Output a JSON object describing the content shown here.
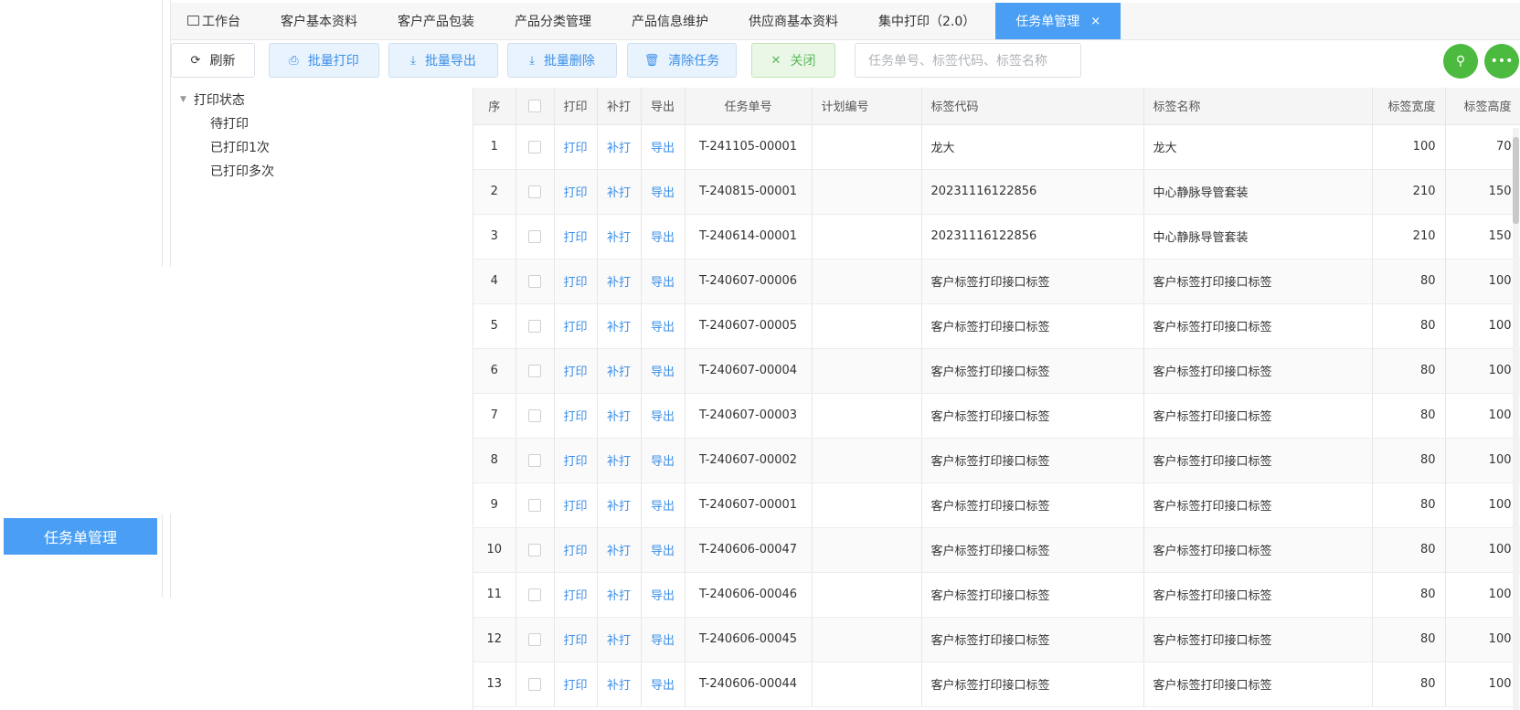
{
  "side_tab": "任务单管理",
  "tabs": [
    {
      "label": "工作台"
    },
    {
      "label": "客户基本资料"
    },
    {
      "label": "客户产品包装"
    },
    {
      "label": "产品分类管理"
    },
    {
      "label": "产品信息维护"
    },
    {
      "label": "供应商基本资料"
    },
    {
      "label": "集中打印（2.0）"
    },
    {
      "label": "任务单管理",
      "close": "×"
    }
  ],
  "toolbar": {
    "refresh": "刷新",
    "batch_print": "批量打印",
    "batch_export": "批量导出",
    "batch_delete": "批量删除",
    "clear_tasks": "清除任务",
    "close": "关闭",
    "search_placeholder": "任务单号、标签代码、标签名称"
  },
  "tree": {
    "root": "打印状态",
    "children": [
      "待打印",
      "已打印1次",
      "已打印多次"
    ]
  },
  "table": {
    "headers": [
      "序",
      "",
      "打印",
      "补打",
      "导出",
      "任务单号",
      "计划编号",
      "标签代码",
      "标签名称",
      "标签宽度",
      "标签高度"
    ],
    "action_print": "打印",
    "action_reprint": "补打",
    "action_export": "导出",
    "rows": [
      {
        "seq": "1",
        "task_no": "T-241105-00001",
        "plan_no": "",
        "code": "龙大",
        "name": "龙大",
        "width": "100",
        "height": "70"
      },
      {
        "seq": "2",
        "task_no": "T-240815-00001",
        "plan_no": "",
        "code": "20231116122856",
        "name": "中心静脉导管套装",
        "width": "210",
        "height": "150"
      },
      {
        "seq": "3",
        "task_no": "T-240614-00001",
        "plan_no": "",
        "code": "20231116122856",
        "name": "中心静脉导管套装",
        "width": "210",
        "height": "150"
      },
      {
        "seq": "4",
        "task_no": "T-240607-00006",
        "plan_no": "",
        "code": "客户标签打印接口标签",
        "name": "客户标签打印接口标签",
        "width": "80",
        "height": "100"
      },
      {
        "seq": "5",
        "task_no": "T-240607-00005",
        "plan_no": "",
        "code": "客户标签打印接口标签",
        "name": "客户标签打印接口标签",
        "width": "80",
        "height": "100"
      },
      {
        "seq": "6",
        "task_no": "T-240607-00004",
        "plan_no": "",
        "code": "客户标签打印接口标签",
        "name": "客户标签打印接口标签",
        "width": "80",
        "height": "100"
      },
      {
        "seq": "7",
        "task_no": "T-240607-00003",
        "plan_no": "",
        "code": "客户标签打印接口标签",
        "name": "客户标签打印接口标签",
        "width": "80",
        "height": "100"
      },
      {
        "seq": "8",
        "task_no": "T-240607-00002",
        "plan_no": "",
        "code": "客户标签打印接口标签",
        "name": "客户标签打印接口标签",
        "width": "80",
        "height": "100"
      },
      {
        "seq": "9",
        "task_no": "T-240607-00001",
        "plan_no": "",
        "code": "客户标签打印接口标签",
        "name": "客户标签打印接口标签",
        "width": "80",
        "height": "100"
      },
      {
        "seq": "10",
        "task_no": "T-240606-00047",
        "plan_no": "",
        "code": "客户标签打印接口标签",
        "name": "客户标签打印接口标签",
        "width": "80",
        "height": "100"
      },
      {
        "seq": "11",
        "task_no": "T-240606-00046",
        "plan_no": "",
        "code": "客户标签打印接口标签",
        "name": "客户标签打印接口标签",
        "width": "80",
        "height": "100"
      },
      {
        "seq": "12",
        "task_no": "T-240606-00045",
        "plan_no": "",
        "code": "客户标签打印接口标签",
        "name": "客户标签打印接口标签",
        "width": "80",
        "height": "100"
      },
      {
        "seq": "13",
        "task_no": "T-240606-00044",
        "plan_no": "",
        "code": "客户标签打印接口标签",
        "name": "客户标签打印接口标签",
        "width": "80",
        "height": "100"
      }
    ]
  },
  "colors": {
    "accent": "#4a9ff5",
    "green": "#4cb93f",
    "link": "#3b8fe8"
  }
}
